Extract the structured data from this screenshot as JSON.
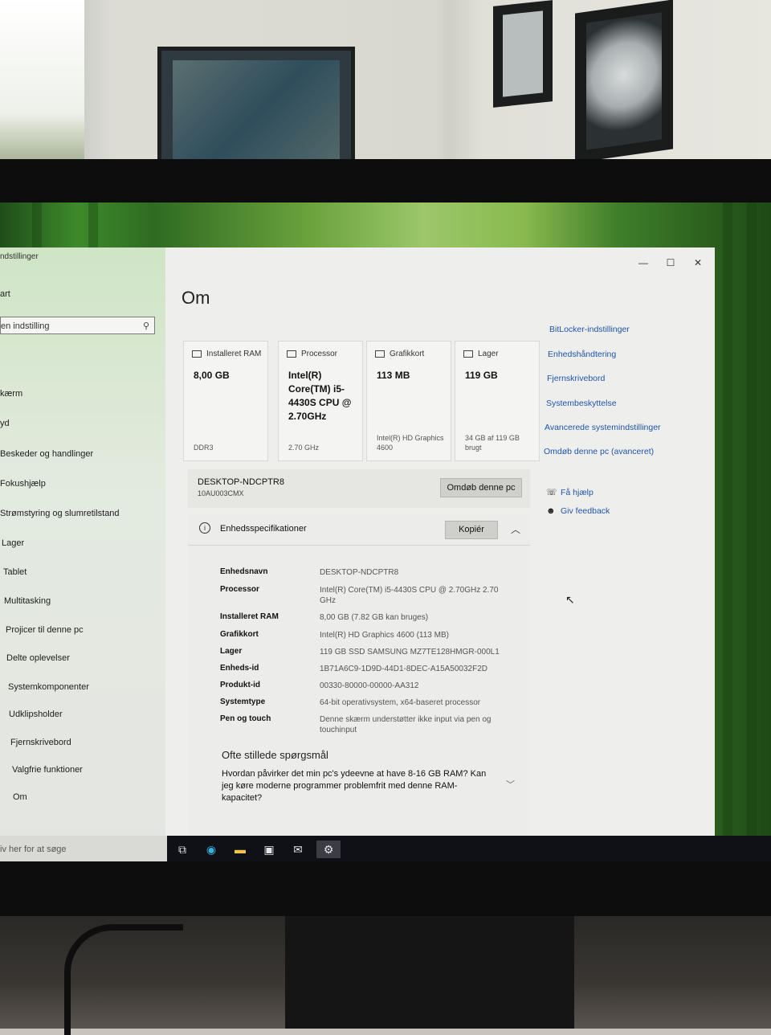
{
  "window": {
    "app_title": "ndstillinger",
    "controls": {
      "minimize": "—",
      "maximize": "☐",
      "close": "✕"
    }
  },
  "sidebar": {
    "home_label": "art",
    "search_placeholder": "en indstilling",
    "search_icon": "search-icon",
    "items": [
      {
        "label": "",
        "icon": "display-icon"
      },
      {
        "label": "kærm",
        "icon": "display-icon"
      },
      {
        "label": "yd",
        "icon": "sound-icon"
      },
      {
        "label": "Beskeder og handlinger",
        "icon": "notifications-icon"
      },
      {
        "label": "Fokushjælp",
        "icon": "moon-icon"
      },
      {
        "label": "Strømstyring og slumretilstand",
        "icon": "power-icon"
      },
      {
        "label": "Lager",
        "icon": "storage-icon"
      },
      {
        "label": "Tablet",
        "icon": "tablet-icon"
      },
      {
        "label": "Multitasking",
        "icon": "multitasking-icon"
      },
      {
        "label": "Projicer til denne pc",
        "icon": "project-icon"
      },
      {
        "label": "Delte oplevelser",
        "icon": "share-icon"
      },
      {
        "label": "Systemkomponenter",
        "icon": "components-icon"
      },
      {
        "label": "Udklipsholder",
        "icon": "clipboard-icon"
      },
      {
        "label": "Fjernskrivebord",
        "icon": "remote-icon"
      },
      {
        "label": "Valgfrie funktioner",
        "icon": "features-icon"
      },
      {
        "label": "Om",
        "icon": "info-icon"
      }
    ]
  },
  "main": {
    "title": "Om",
    "cards": [
      {
        "header": "Installeret RAM",
        "value": "8,00 GB",
        "sub": "DDR3"
      },
      {
        "header": "Processor",
        "value": "Intel(R) Core(TM) i5-4430S CPU @ 2.70GHz",
        "sub": "2.70 GHz"
      },
      {
        "header": "Grafikkort",
        "value": "113 MB",
        "sub": "Intel(R) HD Graphics 4600"
      },
      {
        "header": "Lager",
        "value": "119 GB",
        "sub": "34 GB af 119 GB brugt"
      }
    ],
    "pc_name": "DESKTOP-NDCPTR8",
    "pc_model": "10AU003CMX",
    "rename_button": "Omdøb denne pc",
    "specs": {
      "header": "Enhedsspecifikationer",
      "copy_button": "Kopiér",
      "rows": [
        {
          "key": "Enhedsnavn",
          "value": "DESKTOP-NDCPTR8"
        },
        {
          "key": "Processor",
          "value": "Intel(R) Core(TM) i5-4430S CPU @ 2.70GHz 2.70 GHz"
        },
        {
          "key": "Installeret RAM",
          "value": "8,00 GB (7.82 GB kan bruges)"
        },
        {
          "key": "Grafikkort",
          "value": "Intel(R) HD Graphics 4600 (113 MB)"
        },
        {
          "key": "Lager",
          "value": "119 GB SSD SAMSUNG MZ7TE128HMGR-000L1"
        },
        {
          "key": "Enheds-id",
          "value": "1B71A6C9-1D9D-44D1-8DEC-A15A50032F2D"
        },
        {
          "key": "Produkt-id",
          "value": "00330-80000-00000-AA312"
        },
        {
          "key": "Systemtype",
          "value": "64-bit operativsystem, x64-baseret processor"
        },
        {
          "key": "Pen og touch",
          "value": "Denne skærm understøtter ikke input via pen og touchinput"
        }
      ]
    },
    "faq": {
      "title": "Ofte stillede spørgsmål",
      "question": "Hvordan påvirker det min pc's ydeevne at have 8-16 GB RAM? Kan jeg køre moderne programmer problemfrit med denne RAM-kapacitet?"
    }
  },
  "related_links": [
    "BitLocker-indstillinger",
    "Enhedshåndtering",
    "Fjernskrivebord",
    "Systembeskyttelse",
    "Avancerede systemindstillinger",
    "Omdøb denne pc (avanceret)"
  ],
  "help": [
    {
      "label": "Få hjælp",
      "icon": "help-icon"
    },
    {
      "label": "Giv feedback",
      "icon": "feedback-icon"
    }
  ],
  "taskbar": {
    "search_placeholder": "iv her for at søge",
    "apps": [
      "task-view-icon",
      "edge-icon",
      "file-explorer-icon",
      "store-icon",
      "mail-icon",
      "settings-icon"
    ]
  }
}
